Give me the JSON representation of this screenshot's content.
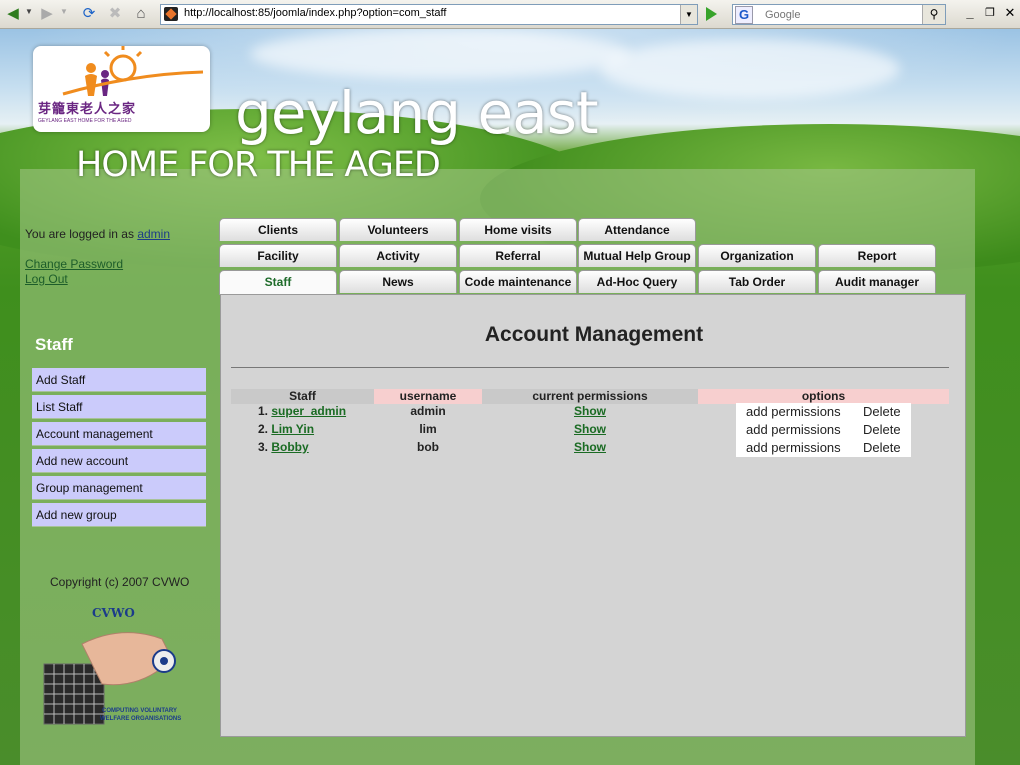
{
  "browser": {
    "url": "http://localhost:85/joomla/index.php?option=com_staff",
    "search_placeholder": "Google",
    "search_engine_letter": "G"
  },
  "site": {
    "logo_zh": "芽籠東老人之家",
    "logo_en": "GEYLANG EAST HOME FOR THE AGED",
    "title": "geylang east",
    "subtitle": "HOME FOR THE AGED"
  },
  "user": {
    "logged_in_prefix": "You are logged in as",
    "username": "admin",
    "change_password": "Change Password",
    "log_out": "Log Out"
  },
  "sidebar": {
    "title": "Staff",
    "items": [
      {
        "label": "Add Staff"
      },
      {
        "label": "List Staff"
      },
      {
        "label": "Account management"
      },
      {
        "label": "Add new account"
      },
      {
        "label": "Group management"
      },
      {
        "label": "Add new group"
      }
    ],
    "copyright": "Copyright (c) 2007 CVWO",
    "cvwo_logo_text": "CVWO",
    "cvwo_caption_1": "COMPUTING VOLUNTARY",
    "cvwo_caption_2": "WELFARE ORGANISATIONS"
  },
  "tabs": {
    "row1": [
      "Clients",
      "Volunteers",
      "Home visits",
      "Attendance"
    ],
    "row2": [
      "Facility",
      "Activity",
      "Referral",
      "Mutual Help Group",
      "Organization",
      "Report"
    ],
    "row3": [
      "Staff",
      "News",
      "Code maintenance",
      "Ad-Hoc Query",
      "Tab Order",
      "Audit manager"
    ],
    "active": "Staff"
  },
  "main": {
    "title": "Account Management",
    "headers": {
      "staff": "Staff",
      "username": "username",
      "permissions": "current permissions",
      "options": "options"
    },
    "colors": {
      "header_gray": "#c9c9c9",
      "header_pink": "#f7cfcf"
    },
    "rows": [
      {
        "num": "1.",
        "staff": "super_admin",
        "username": "admin",
        "permissions": "Show",
        "add": "add permissions",
        "delete": "Delete"
      },
      {
        "num": "2.",
        "staff": "Lim Yin",
        "username": "lim",
        "permissions": "Show",
        "add": "add permissions",
        "delete": "Delete"
      },
      {
        "num": "3.",
        "staff": "Bobby",
        "username": "bob",
        "permissions": "Show",
        "add": "add permissions",
        "delete": "Delete"
      }
    ]
  }
}
